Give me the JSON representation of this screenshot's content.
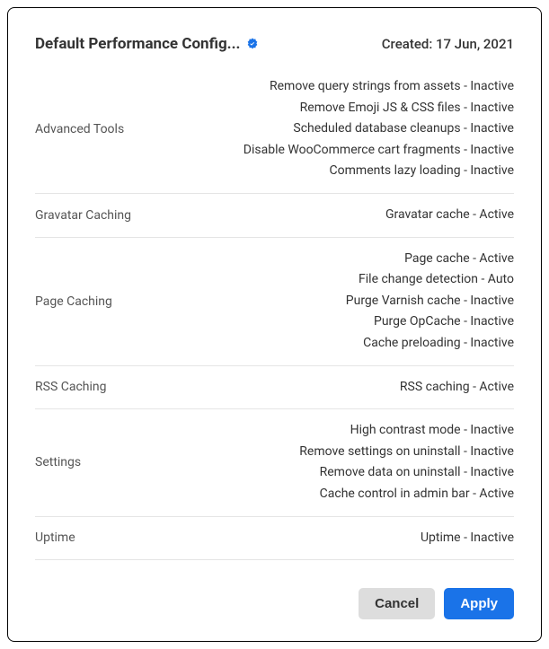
{
  "header": {
    "title": "Default Performance Config...",
    "created_label": "Created: 17 Jun, 2021"
  },
  "sections": [
    {
      "label": "Advanced Tools",
      "items": [
        "Remove query strings from assets - Inactive",
        "Remove Emoji JS & CSS files - Inactive",
        "Scheduled database cleanups - Inactive",
        "Disable WooCommerce cart fragments - Inactive",
        "Comments lazy loading - Inactive"
      ]
    },
    {
      "label": "Gravatar Caching",
      "items": [
        "Gravatar cache - Active"
      ]
    },
    {
      "label": "Page Caching",
      "items": [
        "Page cache - Active",
        "File change detection - Auto",
        "Purge Varnish cache - Inactive",
        "Purge OpCache - Inactive",
        "Cache preloading - Inactive"
      ]
    },
    {
      "label": "RSS Caching",
      "items": [
        "RSS caching - Active"
      ]
    },
    {
      "label": "Settings",
      "items": [
        "High contrast mode - Inactive",
        "Remove settings on uninstall - Inactive",
        "Remove data on uninstall - Inactive",
        "Cache control in admin bar - Active"
      ]
    },
    {
      "label": "Uptime",
      "items": [
        "Uptime - Inactive"
      ]
    }
  ],
  "footer": {
    "cancel_label": "Cancel",
    "apply_label": "Apply"
  }
}
